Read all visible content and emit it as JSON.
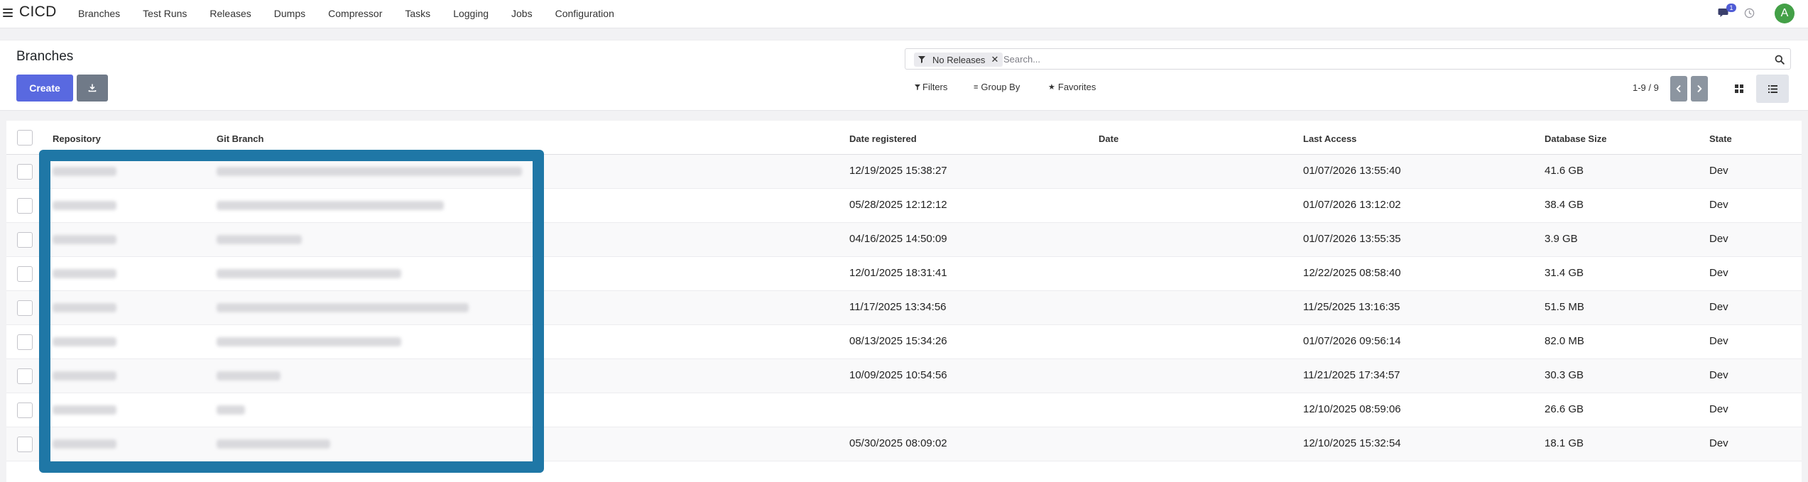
{
  "app": {
    "title": "CICD"
  },
  "nav": {
    "items": [
      "Branches",
      "Test Runs",
      "Releases",
      "Dumps",
      "Compressor",
      "Tasks",
      "Logging",
      "Jobs",
      "Configuration"
    ],
    "chat_badge": "1",
    "avatar_letter": "A"
  },
  "control": {
    "breadcrumb": "Branches",
    "create_label": "Create",
    "facet_label": "No Releases",
    "search_placeholder": "Search...",
    "filters_label": "Filters",
    "groupby_label": "Group By",
    "favorites_label": "Favorites",
    "pager": "1-9 / 9"
  },
  "table": {
    "headers": {
      "repository": "Repository",
      "git_branch": "Git Branch",
      "date_registered": "Date registered",
      "date": "Date",
      "last_access": "Last Access",
      "database_size": "Database Size",
      "state": "State"
    },
    "rows": [
      {
        "date_registered": "12/19/2025 15:38:27",
        "date": "",
        "last_access": "01/07/2026 13:55:40",
        "database_size": "41.6 GB",
        "state": "Dev"
      },
      {
        "date_registered": "05/28/2025 12:12:12",
        "date": "",
        "last_access": "01/07/2026 13:12:02",
        "database_size": "38.4 GB",
        "state": "Dev"
      },
      {
        "date_registered": "04/16/2025 14:50:09",
        "date": "",
        "last_access": "01/07/2026 13:55:35",
        "database_size": "3.9 GB",
        "state": "Dev"
      },
      {
        "date_registered": "12/01/2025 18:31:41",
        "date": "",
        "last_access": "12/22/2025 08:58:40",
        "database_size": "31.4 GB",
        "state": "Dev"
      },
      {
        "date_registered": "11/17/2025 13:34:56",
        "date": "",
        "last_access": "11/25/2025 13:16:35",
        "database_size": "51.5 MB",
        "state": "Dev"
      },
      {
        "date_registered": "08/13/2025 15:34:26",
        "date": "",
        "last_access": "01/07/2026 09:56:14",
        "database_size": "82.0 MB",
        "state": "Dev"
      },
      {
        "date_registered": "10/09/2025 10:54:56",
        "date": "",
        "last_access": "11/21/2025 17:34:57",
        "database_size": "30.3 GB",
        "state": "Dev"
      },
      {
        "date_registered": "",
        "date": "",
        "last_access": "12/10/2025 08:59:06",
        "database_size": "26.6 GB",
        "state": "Dev"
      },
      {
        "date_registered": "05/30/2025 08:09:02",
        "date": "",
        "last_access": "12/10/2025 15:32:54",
        "database_size": "18.1 GB",
        "state": "Dev"
      }
    ]
  },
  "colors": {
    "primary": "#5969e0",
    "secondary": "#707a88",
    "redaction": "#1f77a6",
    "avatar": "#43a047"
  },
  "icons": [
    "hamburger-icon",
    "chat-icon",
    "clock-icon",
    "download-icon",
    "funnel-icon",
    "close-icon",
    "search-icon",
    "chevron-left-icon",
    "chevron-right-icon",
    "kanban-view-icon",
    "list-view-icon"
  ]
}
